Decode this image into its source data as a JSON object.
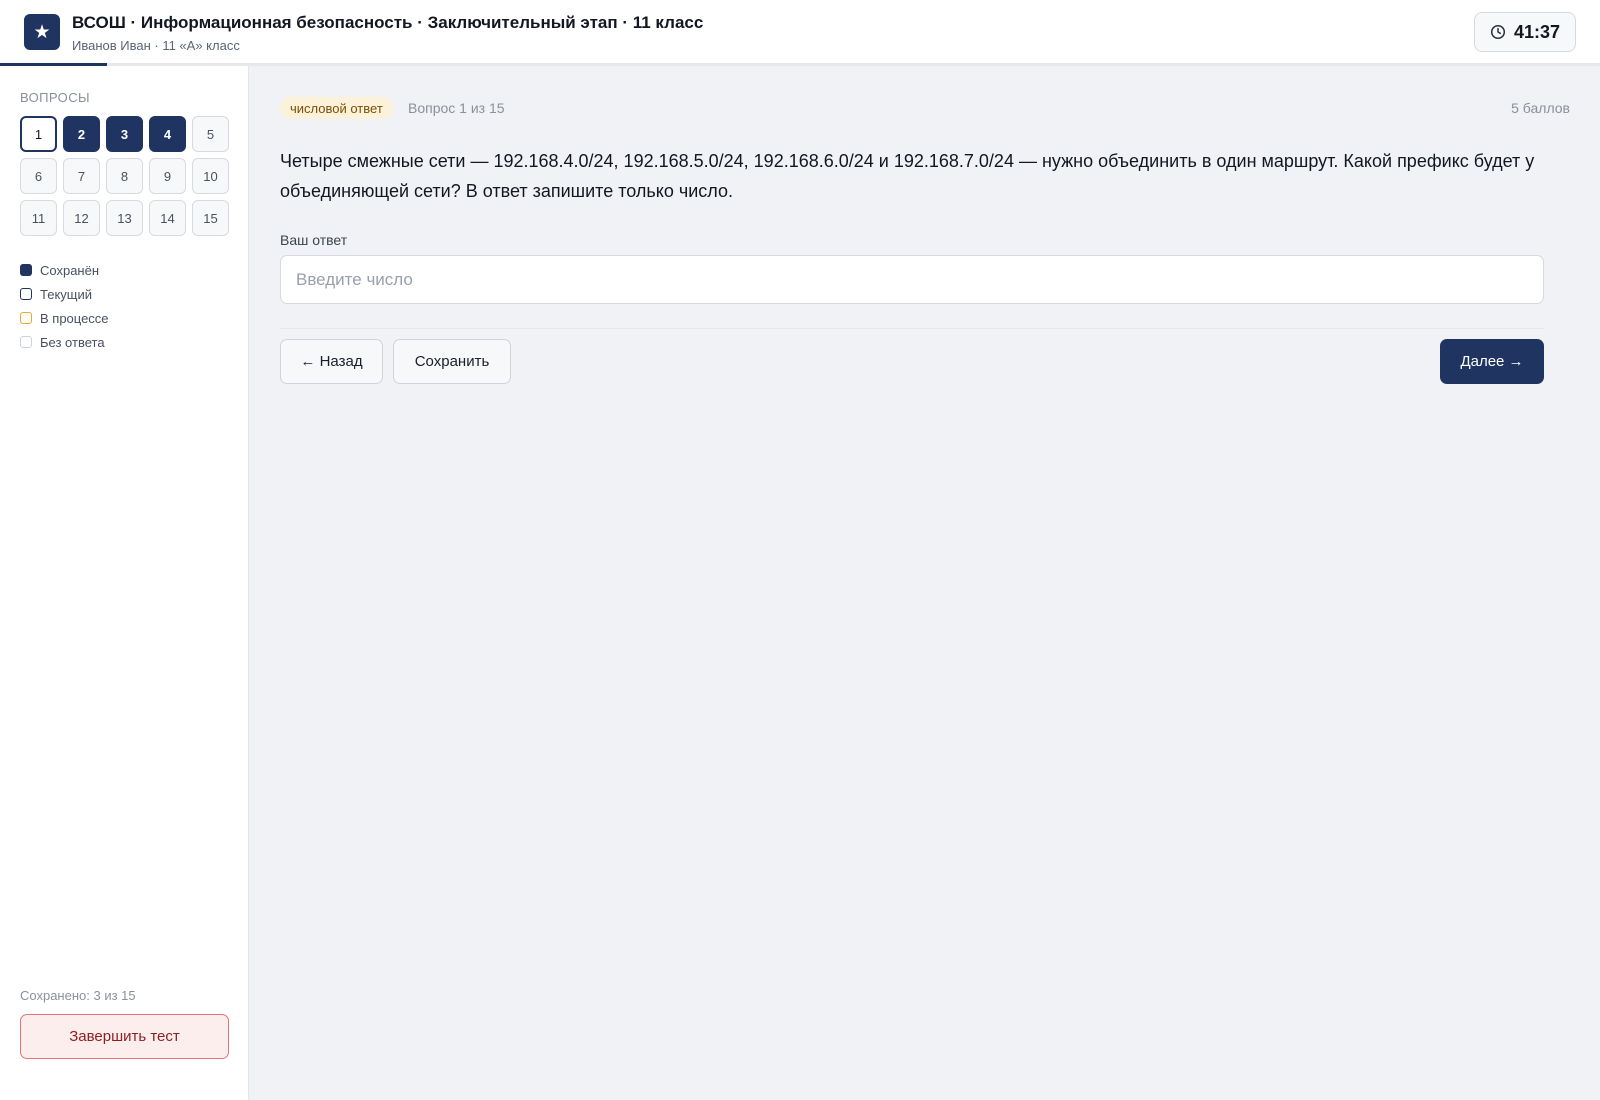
{
  "header": {
    "logo_glyph": "★",
    "title": "ВСОШ · Информационная безопасность · Заключительный этап · 11 класс",
    "subtitle": "Иванов Иван · 11 «А» класс",
    "timer": "41:37",
    "progress_fraction": 0.0667
  },
  "sidebar": {
    "heading": "ВОПРОСЫ",
    "questions": [
      {
        "label": "1",
        "state": "current"
      },
      {
        "label": "2",
        "state": "saved"
      },
      {
        "label": "3",
        "state": "saved"
      },
      {
        "label": "4",
        "state": "saved"
      },
      {
        "label": "5",
        "state": "empty"
      },
      {
        "label": "6",
        "state": "empty"
      },
      {
        "label": "7",
        "state": "empty"
      },
      {
        "label": "8",
        "state": "empty"
      },
      {
        "label": "9",
        "state": "empty"
      },
      {
        "label": "10",
        "state": "empty"
      },
      {
        "label": "11",
        "state": "empty"
      },
      {
        "label": "12",
        "state": "empty"
      },
      {
        "label": "13",
        "state": "empty"
      },
      {
        "label": "14",
        "state": "empty"
      },
      {
        "label": "15",
        "state": "empty"
      }
    ],
    "legend": [
      {
        "key": "saved",
        "label": "Сохранён"
      },
      {
        "key": "current",
        "label": "Текущий"
      },
      {
        "key": "progress",
        "label": "В процессе"
      },
      {
        "key": "empty",
        "label": "Без ответа"
      }
    ],
    "saved_count": "Сохранено: 3 из 15",
    "finish_label": "Завершить тест"
  },
  "main": {
    "type_badge": "числовой ответ",
    "counter": "Вопрос 1 из 15",
    "points": "5 баллов",
    "question": "Четыре смежные сети — 192.168.4.0/24, 192.168.5.0/24, 192.168.6.0/24 и 192.168.7.0/24 — нужно объединить в один маршрут. Какой префикс будет у объединяющей сети? В ответ запишите только число.",
    "answer_label": "Ваш ответ",
    "answer_value": "",
    "answer_placeholder": "Введите число",
    "back_label": "← Назад",
    "save_label": "Сохранить",
    "next_label": "Далее →"
  },
  "colors": {
    "primary": "#1f3461",
    "badge_bg": "#fcf1d9",
    "finish_border": "#e2747a",
    "progress_legend": "#e8a82e"
  },
  "icons": {
    "logo": "star-icon",
    "timer": "clock-icon"
  }
}
